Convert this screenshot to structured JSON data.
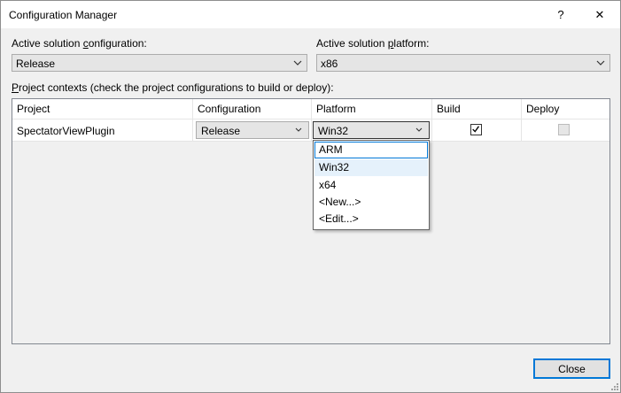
{
  "window": {
    "title": "Configuration Manager",
    "help_glyph": "?",
    "close_glyph": "✕"
  },
  "solution_config": {
    "label_pre": "Active solution ",
    "label_mnemonic": "c",
    "label_post": "onfiguration:",
    "value": "Release"
  },
  "solution_platform": {
    "label_pre": "Active solution ",
    "label_mnemonic": "p",
    "label_post": "latform:",
    "value": "x86"
  },
  "project_contexts": {
    "label_mnemonic": "P",
    "label_post": "roject contexts (check the project configurations to build or deploy):",
    "columns": [
      "Project",
      "Configuration",
      "Platform",
      "Build",
      "Deploy"
    ],
    "rows": [
      {
        "project": "SpectatorViewPlugin",
        "configuration": "Release",
        "platform": "Win32",
        "build": true,
        "deploy": false
      }
    ]
  },
  "platform_dropdown": {
    "options": [
      "ARM",
      "Win32",
      "x64",
      "<New...>",
      "<Edit...>"
    ],
    "focused": "ARM",
    "selected": "Win32"
  },
  "buttons": {
    "close": "Close"
  }
}
